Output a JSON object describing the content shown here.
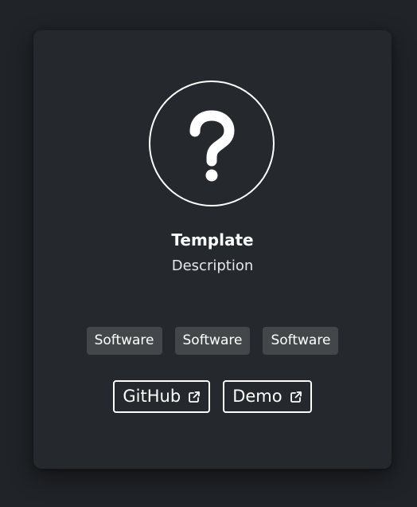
{
  "card": {
    "avatar_icon": "question-mark-icon",
    "title": "Template",
    "description": "Description",
    "tags": [
      "Software",
      "Software",
      "Software"
    ],
    "links": [
      {
        "label": "GitHub",
        "icon": "external-link-icon"
      },
      {
        "label": "Demo",
        "icon": "external-link-icon"
      }
    ]
  },
  "colors": {
    "page_background": "#202327",
    "card_background": "#25292d",
    "tag_background": "#44474a",
    "foreground": "#ffffff"
  }
}
